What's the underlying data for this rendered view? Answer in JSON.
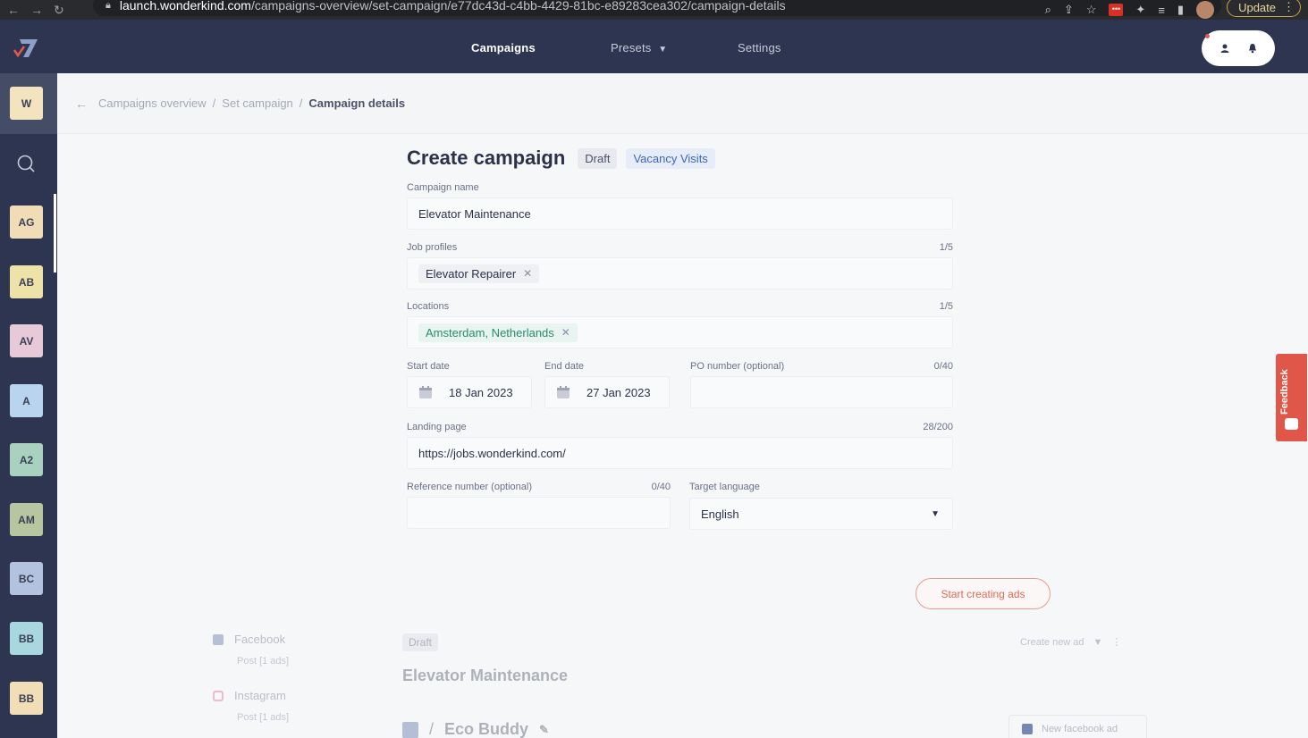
{
  "browser": {
    "url_host": "launch.wonderkind.com",
    "url_path": "/campaigns-overview/set-campaign/e77dc43d-c4bb-4429-81bc-e89283cea302/campaign-details",
    "update_label": "Update"
  },
  "topnav": {
    "campaigns": "Campaigns",
    "presets": "Presets",
    "settings": "Settings"
  },
  "sidebar": {
    "items": [
      {
        "label": "W",
        "color": "#f3e4bf"
      },
      {
        "label": "AG",
        "color": "#f0dcb6"
      },
      {
        "label": "AB",
        "color": "#ede3a8"
      },
      {
        "label": "AV",
        "color": "#e8c9d8"
      },
      {
        "label": "A",
        "color": "#b9d4ee"
      },
      {
        "label": "A2",
        "color": "#a8d1c0"
      },
      {
        "label": "AM",
        "color": "#b7c6a0"
      },
      {
        "label": "BC",
        "color": "#b3c3df"
      },
      {
        "label": "BB",
        "color": "#a9d7e0"
      },
      {
        "label": "BB",
        "color": "#f2deb6"
      }
    ]
  },
  "breadcrumb": {
    "items": [
      "Campaigns overview",
      "Set campaign"
    ],
    "current": "Campaign details"
  },
  "form": {
    "title": "Create campaign",
    "status_badge": "Draft",
    "type_badge": "Vacancy Visits",
    "campaign_name_label": "Campaign name",
    "campaign_name_value": "Elevator Maintenance",
    "job_profiles_label": "Job profiles",
    "job_profiles_count": "1/5",
    "job_profile_chip": "Elevator Repairer",
    "locations_label": "Locations",
    "locations_count": "1/5",
    "location_chip": "Amsterdam, Netherlands",
    "start_date_label": "Start date",
    "start_date_value": "18 Jan 2023",
    "end_date_label": "End date",
    "end_date_value": "27 Jan 2023",
    "po_label": "PO number (optional)",
    "po_count": "0/40",
    "po_value": "",
    "landing_label": "Landing page",
    "landing_count": "28/200",
    "landing_value": "https://jobs.wonderkind.com/",
    "reference_label": "Reference number (optional)",
    "reference_count": "0/40",
    "reference_value": "",
    "language_label": "Target language",
    "language_value": "English"
  },
  "start_button": "Start creating ads",
  "background": {
    "facebook": "Facebook",
    "facebook_sub": "Post [1 ads]",
    "instagram": "Instagram",
    "instagram_sub": "Post [1 ads]",
    "draft": "Draft",
    "campaign_title": "Elevator Maintenance",
    "create_new_ad": "Create new ad",
    "eco_buddy": "Eco Buddy",
    "new_facebook_ad": "New facebook ad"
  },
  "feedback_label": "Feedback"
}
